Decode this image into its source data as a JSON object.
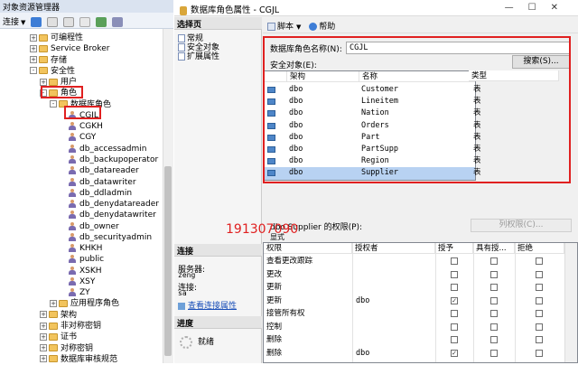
{
  "object_explorer": {
    "title": "对象资源管理器",
    "connect_label": "连接",
    "tree": [
      {
        "label": "可编程性",
        "exp": "+",
        "kind": "folder",
        "indent": 3
      },
      {
        "label": "Service Broker",
        "exp": "+",
        "kind": "folder",
        "indent": 3
      },
      {
        "label": "存储",
        "exp": "+",
        "kind": "folder",
        "indent": 3
      },
      {
        "label": "安全性",
        "exp": "-",
        "kind": "folder",
        "indent": 3
      },
      {
        "label": "用户",
        "exp": "+",
        "kind": "folder",
        "indent": 4
      },
      {
        "label": "角色",
        "exp": "-",
        "kind": "folder",
        "indent": 4
      },
      {
        "label": "数据库角色",
        "exp": "-",
        "kind": "folder",
        "indent": 5
      },
      {
        "label": "CGJL",
        "exp": "",
        "kind": "role",
        "indent": 6
      },
      {
        "label": "CGKH",
        "exp": "",
        "kind": "role",
        "indent": 6
      },
      {
        "label": "CGY",
        "exp": "",
        "kind": "role",
        "indent": 6
      },
      {
        "label": "db_accessadmin",
        "exp": "",
        "kind": "role",
        "indent": 6
      },
      {
        "label": "db_backupoperator",
        "exp": "",
        "kind": "role",
        "indent": 6
      },
      {
        "label": "db_datareader",
        "exp": "",
        "kind": "role",
        "indent": 6
      },
      {
        "label": "db_datawriter",
        "exp": "",
        "kind": "role",
        "indent": 6
      },
      {
        "label": "db_ddladmin",
        "exp": "",
        "kind": "role",
        "indent": 6
      },
      {
        "label": "db_denydatareader",
        "exp": "",
        "kind": "role",
        "indent": 6
      },
      {
        "label": "db_denydatawriter",
        "exp": "",
        "kind": "role",
        "indent": 6
      },
      {
        "label": "db_owner",
        "exp": "",
        "kind": "role",
        "indent": 6
      },
      {
        "label": "db_securityadmin",
        "exp": "",
        "kind": "role",
        "indent": 6
      },
      {
        "label": "KHKH",
        "exp": "",
        "kind": "role",
        "indent": 6
      },
      {
        "label": "public",
        "exp": "",
        "kind": "role",
        "indent": 6
      },
      {
        "label": "XSKH",
        "exp": "",
        "kind": "role",
        "indent": 6
      },
      {
        "label": "XSY",
        "exp": "",
        "kind": "role",
        "indent": 6
      },
      {
        "label": "ZY",
        "exp": "",
        "kind": "role",
        "indent": 6
      },
      {
        "label": "应用程序角色",
        "exp": "+",
        "kind": "folder",
        "indent": 5
      },
      {
        "label": "架构",
        "exp": "+",
        "kind": "folder",
        "indent": 4
      },
      {
        "label": "非对称密钥",
        "exp": "+",
        "kind": "folder",
        "indent": 4
      },
      {
        "label": "证书",
        "exp": "+",
        "kind": "folder",
        "indent": 4
      },
      {
        "label": "对称密钥",
        "exp": "+",
        "kind": "folder",
        "indent": 4
      },
      {
        "label": "数据库审核规范",
        "exp": "+",
        "kind": "folder",
        "indent": 4
      }
    ]
  },
  "dialog": {
    "title": "数据库角色属性 - CGJL",
    "select_page_label": "选择页",
    "pages": [
      "常规",
      "安全对象",
      "扩展属性"
    ],
    "toolbar": {
      "script_label": "脚本",
      "help_label": "帮助"
    },
    "role_name_label": "数据库角色名称(N):",
    "role_name_value": "CGJL",
    "securables_label": "安全对象(E):",
    "search_button": "搜索(S)...",
    "securables_columns": [
      "架构",
      "名称",
      "类型"
    ],
    "securables": [
      {
        "schema": "dbo",
        "name": "Customer",
        "type": "表"
      },
      {
        "schema": "dbo",
        "name": "Lineitem",
        "type": "表"
      },
      {
        "schema": "dbo",
        "name": "Nation",
        "type": "表"
      },
      {
        "schema": "dbo",
        "name": "Orders",
        "type": "表"
      },
      {
        "schema": "dbo",
        "name": "Part",
        "type": "表"
      },
      {
        "schema": "dbo",
        "name": "PartSupp",
        "type": "表"
      },
      {
        "schema": "dbo",
        "name": "Region",
        "type": "表"
      },
      {
        "schema": "dbo",
        "name": "Supplier",
        "type": "表"
      }
    ],
    "perm_label": "dbo.Supplier 的权限(P):",
    "explicit_tab": "显式",
    "column_perm_button": "列权限(C)...",
    "connection": {
      "header": "连接",
      "server_label": "服务器:",
      "server_value": "zeng",
      "conn_label": "连接:",
      "conn_value": "sa",
      "view_link": "查看连接属性"
    },
    "progress": {
      "header": "进度",
      "status": "就绪"
    },
    "perm_columns": [
      "权限",
      "授权者",
      "授予",
      "具有授...",
      "拒绝"
    ],
    "permissions": [
      {
        "perm": "查看更改跟踪",
        "grantor": "",
        "grant": false,
        "with": false,
        "deny": false
      },
      {
        "perm": "更改",
        "grantor": "",
        "grant": false,
        "with": false,
        "deny": false
      },
      {
        "perm": "更新",
        "grantor": "",
        "grant": false,
        "with": false,
        "deny": false
      },
      {
        "perm": "更新",
        "grantor": "dbo",
        "grant": true,
        "with": false,
        "deny": false
      },
      {
        "perm": "接管所有权",
        "grantor": "",
        "grant": false,
        "with": false,
        "deny": false
      },
      {
        "perm": "控制",
        "grantor": "",
        "grant": false,
        "with": false,
        "deny": false
      },
      {
        "perm": "删除",
        "grantor": "",
        "grant": false,
        "with": false,
        "deny": false
      },
      {
        "perm": "删除",
        "grantor": "dbo",
        "grant": true,
        "with": false,
        "deny": false
      }
    ]
  },
  "watermark": "191307090",
  "colors": {
    "annotation_red": "#e02020",
    "selection": "#b8d2f2"
  }
}
